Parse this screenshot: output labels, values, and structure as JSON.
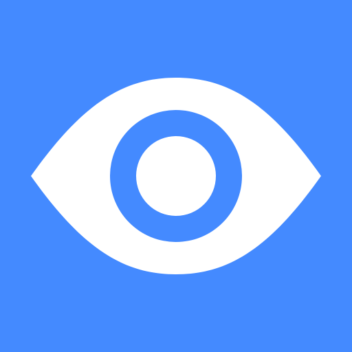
{
  "icon": {
    "name": "eye-icon",
    "background_color": "#448aff",
    "foreground_color": "#ffffff"
  }
}
